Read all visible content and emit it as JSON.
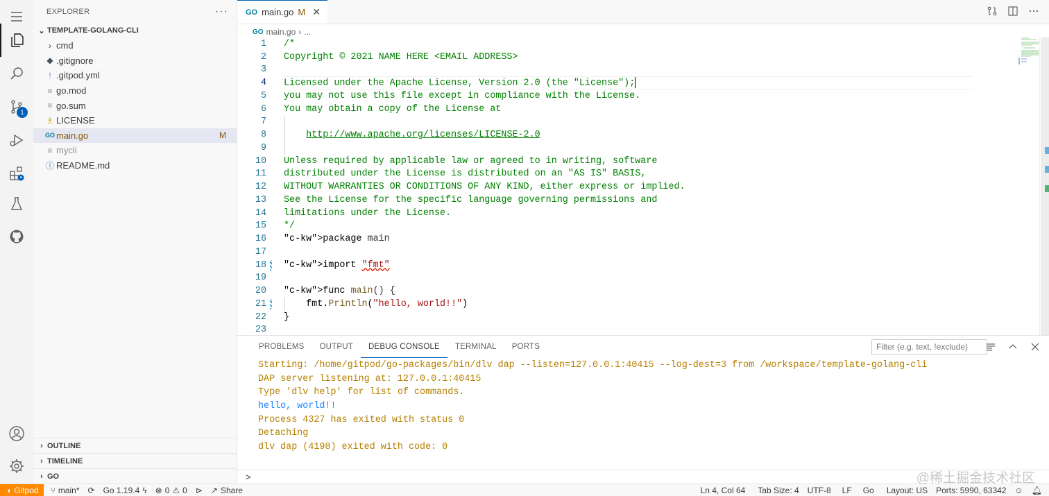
{
  "sidebar": {
    "header": "EXPLORER",
    "more": "···",
    "root": "TEMPLATE-GOLANG-CLI",
    "items": [
      {
        "label": "cmd",
        "icon": "chevron-right",
        "status": ""
      },
      {
        "label": ".gitignore",
        "icon": "gitignore",
        "status": ""
      },
      {
        "label": ".gitpod.yml",
        "icon": "yaml",
        "status": ""
      },
      {
        "label": "go.mod",
        "icon": "lines",
        "status": ""
      },
      {
        "label": "go.sum",
        "icon": "lines",
        "status": ""
      },
      {
        "label": "LICENSE",
        "icon": "license",
        "status": ""
      },
      {
        "label": "main.go",
        "icon": "go",
        "status": "M"
      },
      {
        "label": "mycli",
        "icon": "lines",
        "status": ""
      },
      {
        "label": "README.md",
        "icon": "info",
        "status": ""
      }
    ],
    "sections": [
      "OUTLINE",
      "TIMELINE",
      "GO"
    ]
  },
  "activity": {
    "scm_badge": "1"
  },
  "editor": {
    "tab": {
      "icon": "GO",
      "label": "main.go",
      "modified": "M",
      "close": "✕"
    },
    "breadcrumb": {
      "icon": "GO",
      "file": "main.go",
      "sep": "›",
      "rest": "..."
    },
    "lines": [
      {
        "n": "1",
        "t": "/*"
      },
      {
        "n": "2",
        "t": "Copyright © 2021 NAME HERE <EMAIL ADDRESS>"
      },
      {
        "n": "3",
        "t": ""
      },
      {
        "n": "4",
        "t": "Licensed under the Apache License, Version 2.0 (the \"License\");"
      },
      {
        "n": "5",
        "t": "you may not use this file except in compliance with the License."
      },
      {
        "n": "6",
        "t": "You may obtain a copy of the License at"
      },
      {
        "n": "7",
        "t": ""
      },
      {
        "n": "8",
        "t": "    http://www.apache.org/licenses/LICENSE-2.0"
      },
      {
        "n": "9",
        "t": ""
      },
      {
        "n": "10",
        "t": "Unless required by applicable law or agreed to in writing, software"
      },
      {
        "n": "11",
        "t": "distributed under the License is distributed on an \"AS IS\" BASIS,"
      },
      {
        "n": "12",
        "t": "WITHOUT WARRANTIES OR CONDITIONS OF ANY KIND, either express or implied."
      },
      {
        "n": "13",
        "t": "See the License for the specific language governing permissions and"
      },
      {
        "n": "14",
        "t": "limitations under the License."
      },
      {
        "n": "15",
        "t": "*/"
      },
      {
        "n": "16",
        "t": "package main"
      },
      {
        "n": "17",
        "t": ""
      },
      {
        "n": "18",
        "t": "import \"fmt\""
      },
      {
        "n": "19",
        "t": ""
      },
      {
        "n": "20",
        "t": "func main() {"
      },
      {
        "n": "21",
        "t": "    fmt.Println(\"hello, world!!\")"
      },
      {
        "n": "22",
        "t": "}"
      },
      {
        "n": "23",
        "t": ""
      }
    ]
  },
  "panel": {
    "tabs": [
      "PROBLEMS",
      "OUTPUT",
      "DEBUG CONSOLE",
      "TERMINAL",
      "PORTS"
    ],
    "filter_placeholder": "Filter (e.g. text, !exclude)",
    "console": [
      {
        "t": "Starting: /home/gitpod/go-packages/bin/dlv dap --listen=127.0.0.1:40415 --log-dest=3 from /workspace/template-golang-cli",
        "kind": "warn"
      },
      {
        "t": "DAP server listening at: 127.0.0.1:40415",
        "kind": "warn"
      },
      {
        "t": "Type 'dlv help' for list of commands.",
        "kind": "warn"
      },
      {
        "t": "hello, world!!",
        "kind": "info"
      },
      {
        "t": "Process 4327 has exited with status 0",
        "kind": "warn"
      },
      {
        "t": "Detaching",
        "kind": "warn"
      },
      {
        "t": "dlv dap (4198) exited with code: 0",
        "kind": "warn"
      }
    ],
    "repl_prompt": ">",
    "watermark": "@稀土掘金技术社区"
  },
  "statusbar": {
    "remote": "Gitpod",
    "branch": "main*",
    "go_version": "Go 1.19.4",
    "errors": "0",
    "warnings": "0",
    "share": "Share",
    "position": "Ln 4, Col 64",
    "tab_size": "Tab Size: 4",
    "encoding": "UTF-8",
    "eol": "LF",
    "language": "Go",
    "layout": "Layout: US",
    "ports": "Ports: 5990, 63342"
  }
}
